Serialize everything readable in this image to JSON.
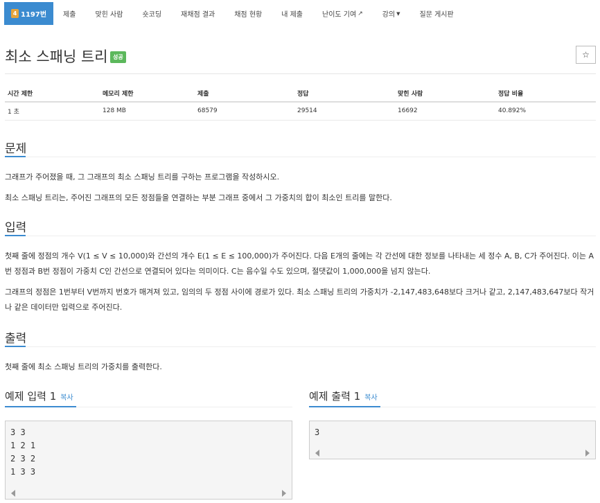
{
  "nav": {
    "problem_tier": "4",
    "problem_id": "1197번",
    "items": [
      "제출",
      "맞힌 사람",
      "숏코딩",
      "재채점 결과",
      "채점 현황",
      "내 제출",
      "난이도 기여",
      "강의",
      "질문 게시판"
    ]
  },
  "title": {
    "text": "최소 스패닝 트리",
    "badge": "성공",
    "star": "☆"
  },
  "info": {
    "headers": [
      "시간 제한",
      "메모리 제한",
      "제출",
      "정답",
      "맞힌 사람",
      "정답 비율"
    ],
    "values": [
      "1 초",
      "128 MB",
      "68579",
      "29514",
      "16692",
      "40.892%"
    ]
  },
  "problem": {
    "heading": "문제",
    "p1": "그래프가 주어졌을 때, 그 그래프의 최소 스패닝 트리를 구하는 프로그램을 작성하시오.",
    "p2": "최소 스패닝 트리는, 주어진 그래프의 모든 정점들을 연결하는 부분 그래프 중에서 그 가중치의 합이 최소인 트리를 말한다."
  },
  "input": {
    "heading": "입력",
    "p1": "첫째 줄에 정점의 개수 V(1 ≤ V ≤ 10,000)와 간선의 개수 E(1 ≤ E ≤ 100,000)가 주어진다. 다음 E개의 줄에는 각 간선에 대한 정보를 나타내는 세 정수 A, B, C가 주어진다. 이는 A번 정점과 B번 정점이 가중치 C인 간선으로 연결되어 있다는 의미이다. C는 음수일 수도 있으며, 절댓값이 1,000,000을 넘지 않는다.",
    "p2": "그래프의 정점은 1번부터 V번까지 번호가 매겨져 있고, 임의의 두 정점 사이에 경로가 있다. 최소 스패닝 트리의 가중치가 -2,147,483,648보다 크거나 같고, 2,147,483,647보다 작거나 같은 데이터만 입력으로 주어진다."
  },
  "output": {
    "heading": "출력",
    "p1": "첫째 줄에 최소 스패닝 트리의 가중치를 출력한다."
  },
  "sample_input": {
    "heading": "예제 입력 1",
    "copy": "복사",
    "text": "3 3\n1 2 1\n2 3 2\n1 3 3"
  },
  "sample_output": {
    "heading": "예제 출력 1",
    "copy": "복사",
    "text": "3"
  }
}
